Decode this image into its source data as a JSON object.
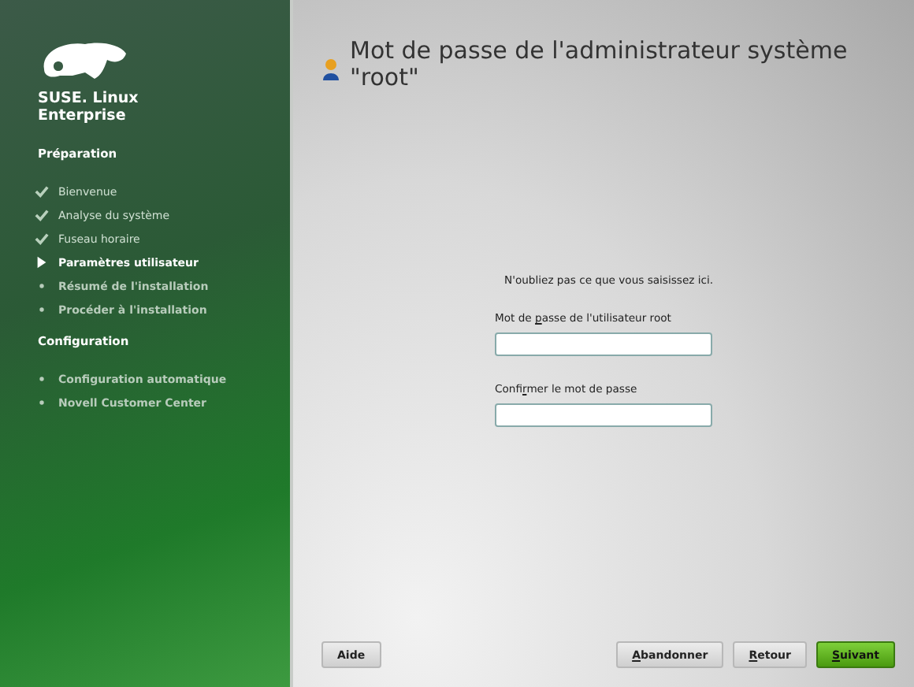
{
  "sidebar": {
    "logo_lines": [
      "SUSE. Linux",
      "Enterprise"
    ],
    "sections": [
      {
        "title": "Préparation",
        "items": [
          {
            "label": "Bienvenue",
            "kind": "done"
          },
          {
            "label": "Analyse du système",
            "kind": "done"
          },
          {
            "label": "Fuseau horaire",
            "kind": "done"
          },
          {
            "label": "Paramètres utilisateur",
            "kind": "current"
          },
          {
            "label": "Résumé de l'installation",
            "kind": "pending"
          },
          {
            "label": "Procéder à l'installation",
            "kind": "pending"
          }
        ]
      },
      {
        "title": "Configuration",
        "items": [
          {
            "label": "Configuration automatique",
            "kind": "pending"
          },
          {
            "label": "Novell Customer Center",
            "kind": "pending"
          }
        ]
      }
    ]
  },
  "page": {
    "title": "Mot de passe de l'administrateur système \"root\"",
    "note": "N'oubliez pas ce que vous saisissez ici.",
    "fields": [
      {
        "before": "Mot de ",
        "key": "p",
        "after": "asse de l'utilisateur root"
      },
      {
        "before": "Confi",
        "key": "r",
        "after": "mer le mot de passe"
      }
    ]
  },
  "buttons": [
    {
      "after": "Aide",
      "kind": "plain"
    },
    {
      "kind": "spacer"
    },
    {
      "key": "A",
      "after": "bandonner",
      "kind": "plain"
    },
    {
      "key": "R",
      "after": "etour",
      "kind": "plain"
    },
    {
      "key": "S",
      "after": "uivant",
      "kind": "primary"
    }
  ]
}
